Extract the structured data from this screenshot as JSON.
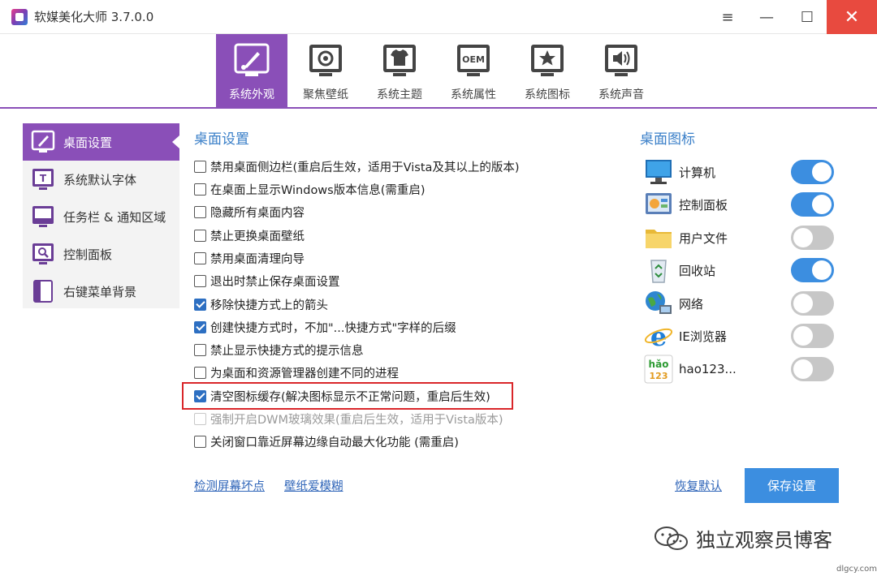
{
  "window": {
    "title": "软媒美化大师 3.7.0.0",
    "menu_glyph": "≡",
    "min_glyph": "—",
    "max_glyph": "☐",
    "close_glyph": "✕"
  },
  "tabs": [
    {
      "label": "系统外观",
      "icon": "brush-icon",
      "active": true
    },
    {
      "label": "聚焦壁纸",
      "icon": "wallpaper-icon"
    },
    {
      "label": "系统主题",
      "icon": "tshirt-icon"
    },
    {
      "label": "系统属性",
      "icon": "oem-icon"
    },
    {
      "label": "系统图标",
      "icon": "star-icon"
    },
    {
      "label": "系统声音",
      "icon": "speaker-icon"
    }
  ],
  "oem_text": "OEM",
  "sidenav": [
    {
      "label": "桌面设置",
      "icon": "desktop-settings-icon",
      "active": true
    },
    {
      "label": "系统默认字体",
      "icon": "font-icon"
    },
    {
      "label": "任务栏 & 通知区域",
      "icon": "taskbar-icon"
    },
    {
      "label": "控制面板",
      "icon": "control-panel-icon"
    },
    {
      "label": "右键菜单背景",
      "icon": "context-menu-icon"
    }
  ],
  "desktop_settings": {
    "title": "桌面设置",
    "options": [
      {
        "label": "禁用桌面侧边栏(重启后生效，适用于Vista及其以上的版本)",
        "checked": false
      },
      {
        "label": "在桌面上显示Windows版本信息(需重启)",
        "checked": false
      },
      {
        "label": "隐藏所有桌面内容",
        "checked": false
      },
      {
        "label": "禁止更换桌面壁纸",
        "checked": false
      },
      {
        "label": "禁用桌面清理向导",
        "checked": false
      },
      {
        "label": "退出时禁止保存桌面设置",
        "checked": false
      },
      {
        "label": "移除快捷方式上的箭头",
        "checked": true
      },
      {
        "label": "创建快捷方式时，不加\"...快捷方式\"字样的后缀",
        "checked": true
      },
      {
        "label": "禁止显示快捷方式的提示信息",
        "checked": false
      },
      {
        "label": "为桌面和资源管理器创建不同的进程",
        "checked": false
      },
      {
        "label": "清空图标缓存(解决图标显示不正常问题，重启后生效)",
        "checked": true
      },
      {
        "label": "强制开启DWM玻璃效果(重启后生效，适用于Vista版本)",
        "checked": false,
        "disabled": true
      },
      {
        "label": "关闭窗口靠近屏幕边缘自动最大化功能 (需重启)",
        "checked": false
      }
    ]
  },
  "desktop_icons": {
    "title": "桌面图标",
    "items": [
      {
        "label": "计算机",
        "icon": "computer-icon",
        "on": true
      },
      {
        "label": "控制面板",
        "icon": "control-panel-icon",
        "on": true
      },
      {
        "label": "用户文件",
        "icon": "folder-icon",
        "on": false
      },
      {
        "label": "回收站",
        "icon": "recycle-bin-icon",
        "on": true
      },
      {
        "label": "网络",
        "icon": "network-icon",
        "on": false
      },
      {
        "label": "IE浏览器",
        "icon": "ie-icon",
        "on": false
      },
      {
        "label": "hao123...",
        "icon": "hao123-icon",
        "on": false
      }
    ]
  },
  "hao123_logo": {
    "top": "hǎo",
    "bottom": "123"
  },
  "links": {
    "detect_pixels": "检测屏幕坏点",
    "wallpaper_fan": "壁纸爱模糊",
    "restore_default": "恢复默认"
  },
  "save_label": "保存设置",
  "watermark": "独立观察员博客",
  "site_mark": "dlgcy.com",
  "colors": {
    "accent": "#8a4fb8",
    "blue": "#3c8ee0",
    "highlight": "#d9262a"
  }
}
